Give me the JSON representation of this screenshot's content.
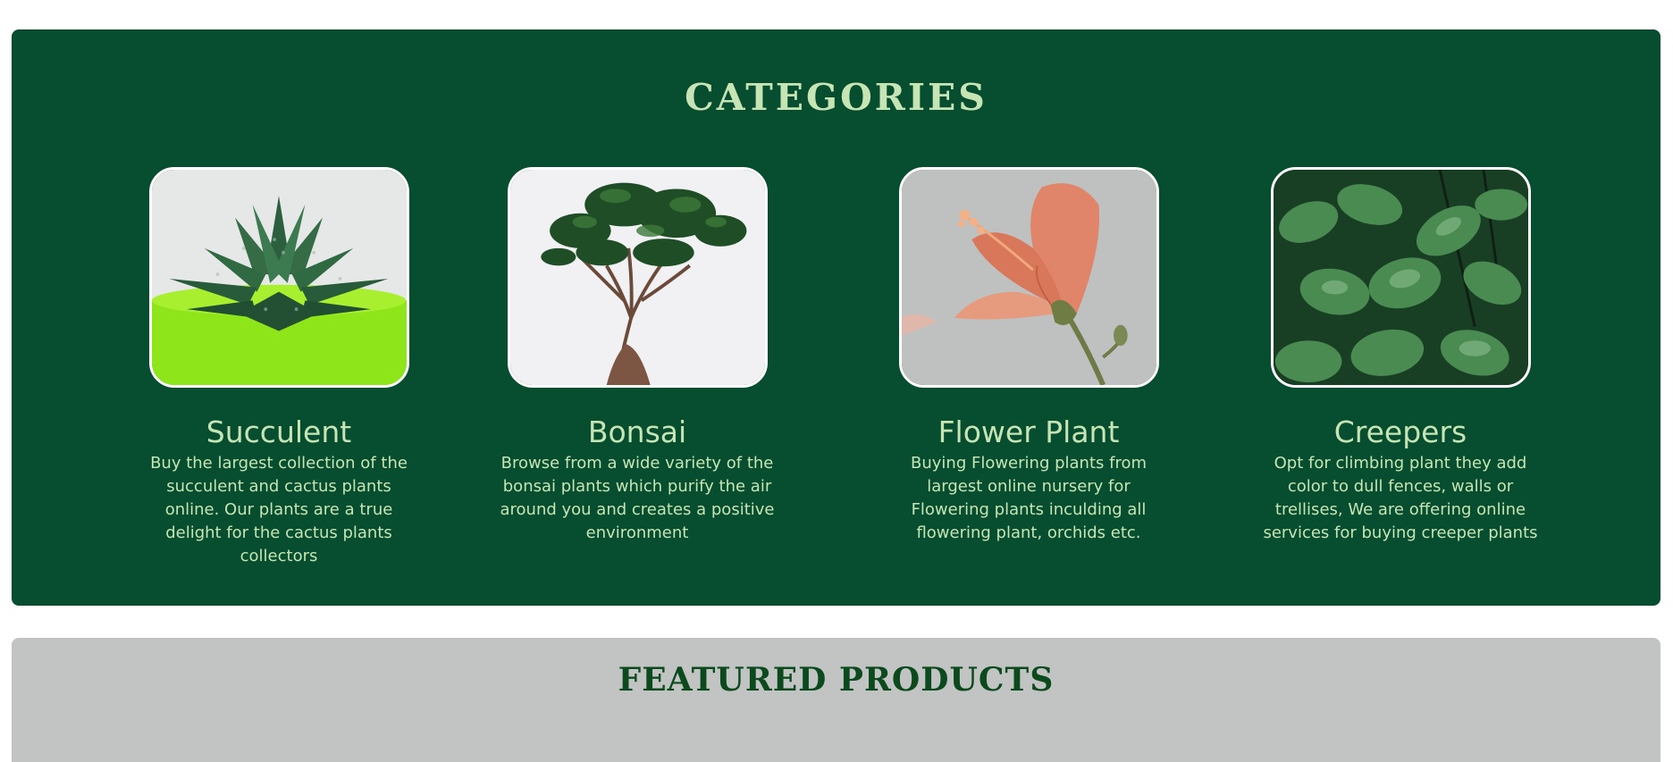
{
  "categories": {
    "title": "CATEGORIES",
    "items": [
      {
        "name": "Succulent",
        "description": "Buy the largest collection of the succulent and cactus plants online. Our plants are a true delight for the cactus plants collectors",
        "image_icon": "succulent-image"
      },
      {
        "name": "Bonsai",
        "description": "Browse from a wide variety of the bonsai plants which purify the air around you and creates a positive environment",
        "image_icon": "bonsai-image"
      },
      {
        "name": "Flower Plant",
        "description": "Buying Flowering plants from largest online nursery for Flowering plants inculding all flowering plant, orchids etc.",
        "image_icon": "flower-plant-image"
      },
      {
        "name": "Creepers",
        "description": "Opt for climbing plant they add color to dull fences, walls or trellises, We are offering online services for buying creeper plants",
        "image_icon": "creepers-image"
      }
    ]
  },
  "featured": {
    "title": "FEATURED PRODUCTS"
  },
  "colors": {
    "categories_bg": "#064e2f",
    "categories_text": "#c6e4b4",
    "featured_bg": "#c1c4c3",
    "featured_title": "#0c4a1e"
  }
}
